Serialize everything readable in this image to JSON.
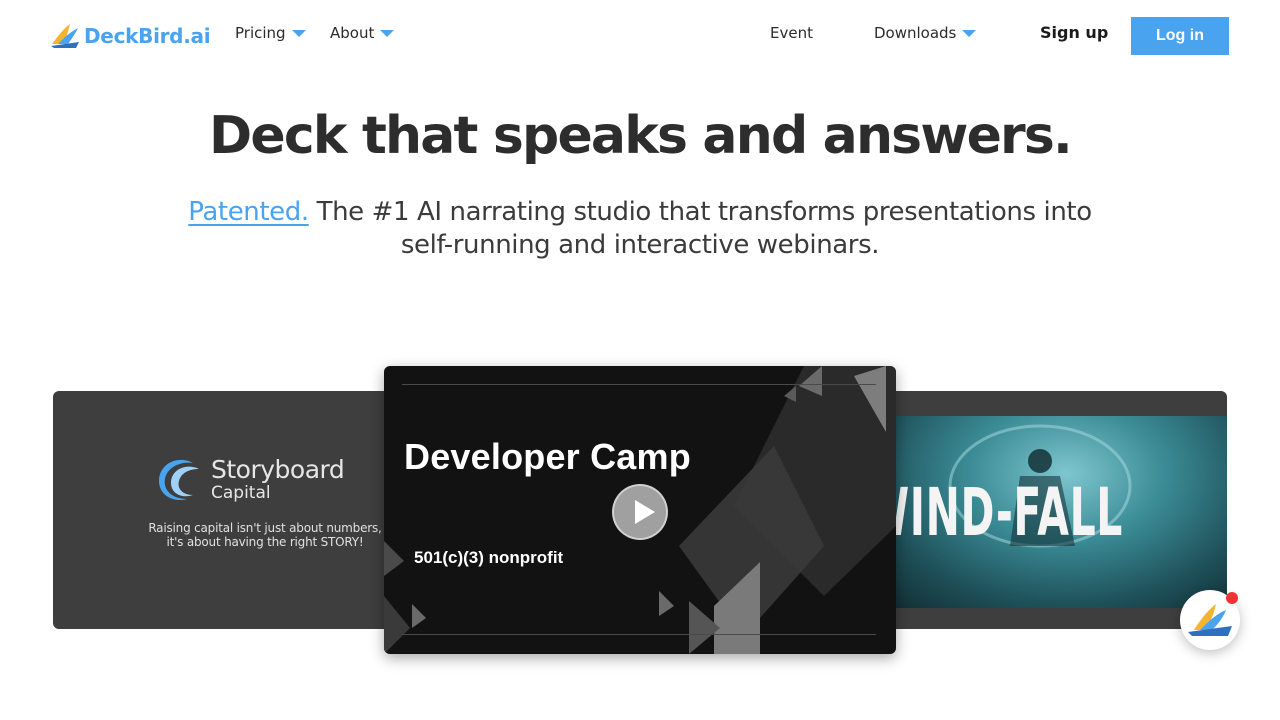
{
  "nav": {
    "logo_text": "DeckBird.ai",
    "pricing": "Pricing",
    "about": "About",
    "event": "Event",
    "downloads": "Downloads",
    "signup": "Sign up",
    "login": "Log in"
  },
  "hero": {
    "title": "Deck that speaks and answers.",
    "patented": "Patented.",
    "subtitle": " The #1 AI narrating studio that transforms presentations into self-running and interactive webinars."
  },
  "carousel": {
    "left": {
      "brand_line1": "Storyboard",
      "brand_line2": "Capital",
      "tagline_line1": "Raising capital isn't just about numbers,",
      "tagline_line2": "it's about having the right STORY!"
    },
    "center": {
      "title": "Developer Camp",
      "subtitle": "501(c)(3) nonprofit"
    },
    "right": {
      "title": "WIND-FALL"
    }
  },
  "colors": {
    "accent": "#4aa3ee",
    "notification": "#ee3333"
  },
  "icons": {
    "dropdown": "chevron-down-icon",
    "play": "play-icon",
    "chat": "deckbird-chat-icon"
  }
}
